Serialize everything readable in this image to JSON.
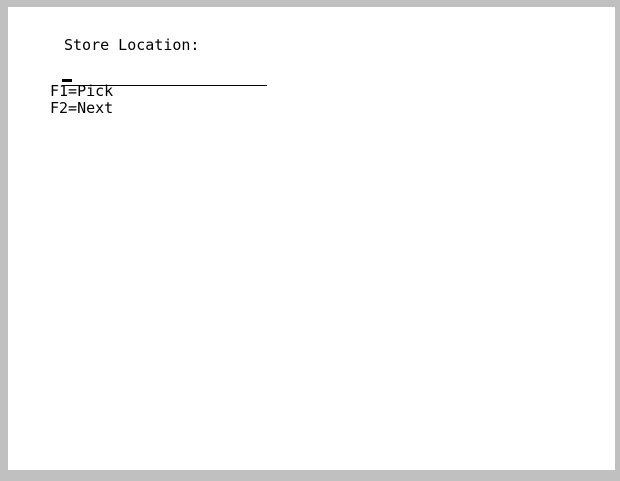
{
  "screen": {
    "prompt_label": "Store Location:",
    "input_value": "",
    "function_keys": [
      {
        "label": "F1=Pick"
      },
      {
        "label": "F2=Next"
      }
    ]
  }
}
